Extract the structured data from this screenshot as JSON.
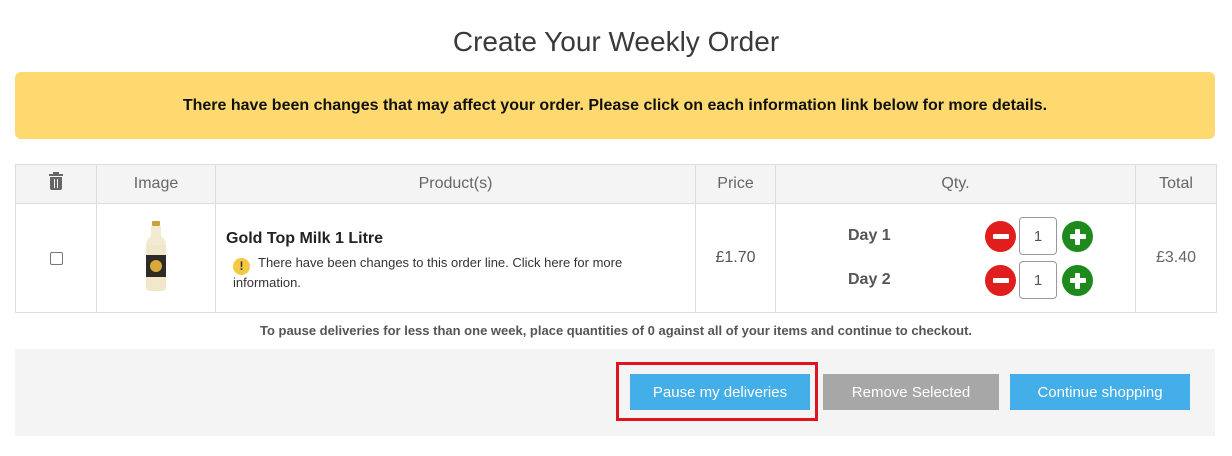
{
  "page": {
    "title": "Create Your Weekly Order",
    "notice": "There have been changes that may affect your order. Please click on each information link below for more details."
  },
  "table": {
    "headers": {
      "delete_icon": "trash-icon",
      "image": "Image",
      "products": "Product(s)",
      "price": "Price",
      "qty": "Qty.",
      "total": "Total"
    },
    "rows": [
      {
        "selected": false,
        "product_name": "Gold Top Milk 1 Litre",
        "change_note": "There have been changes to this order line. Click here for more information.",
        "warning_icon": "!",
        "price": "£1.70",
        "days": [
          {
            "label": "Day 1",
            "quantity": "1"
          },
          {
            "label": "Day 2",
            "quantity": "1"
          }
        ],
        "total": "£3.40"
      }
    ]
  },
  "pause_note": "To pause deliveries for less than one week, place quantities of 0 against all of your items and continue to checkout.",
  "actions": {
    "pause_label": "Pause my deliveries",
    "remove_label": "Remove Selected",
    "continue_label": "Continue shopping"
  },
  "colors": {
    "notice_bg": "#fed970",
    "primary_button": "#43aee8",
    "secondary_button": "#a7a7a7",
    "minus_button": "#e01e1e",
    "plus_button": "#1e8a1e",
    "highlight": "#e0141e"
  }
}
